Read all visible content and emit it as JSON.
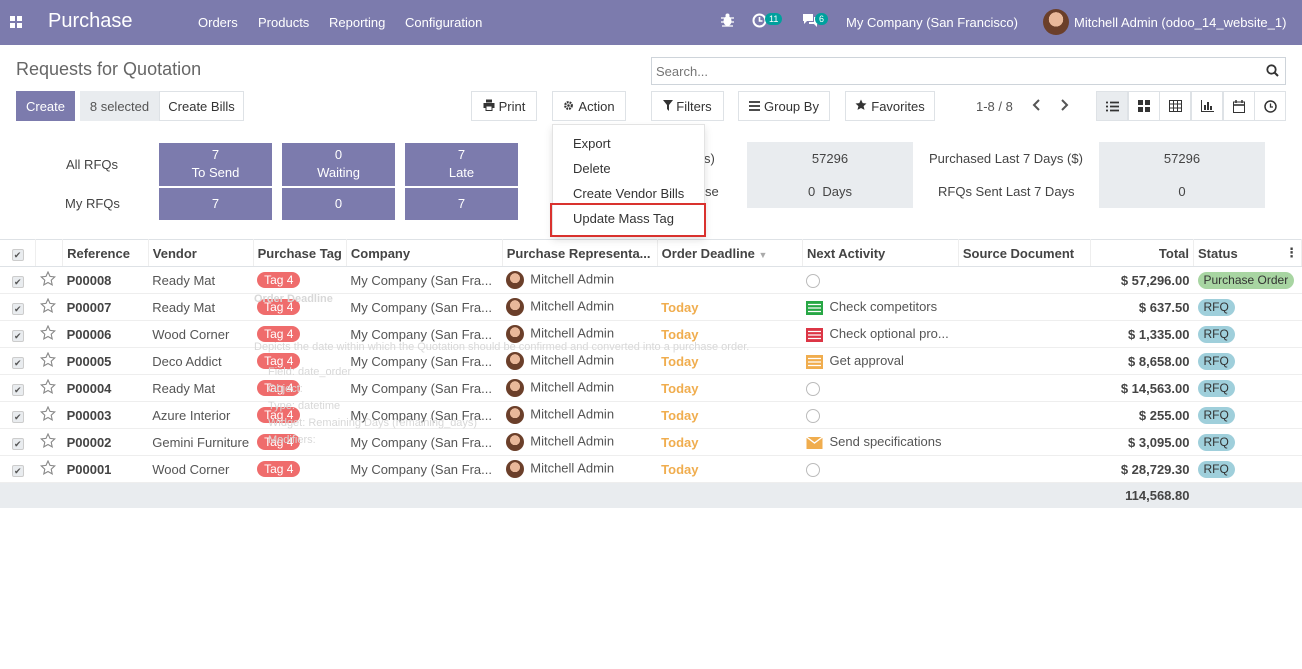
{
  "app": {
    "name": "Purchase"
  },
  "menu": [
    "Orders",
    "Products",
    "Reporting",
    "Configuration"
  ],
  "systray": {
    "activity_count": "11",
    "message_count": "6",
    "company": "My Company (San Francisco)",
    "user": "Mitchell Admin (odoo_14_website_1)"
  },
  "page": {
    "title": "Requests for Quotation"
  },
  "buttons": {
    "create": "Create",
    "selected": "8 selected",
    "create_bills": "Create Bills",
    "print": "Print",
    "action": "Action",
    "filters": "Filters",
    "group_by": "Group By",
    "favorites": "Favorites"
  },
  "search": {
    "placeholder": "Search..."
  },
  "pager": "1-8 / 8",
  "dashboard": {
    "all_rfqs": "All RFQs",
    "my_rfqs": "My RFQs",
    "tiles": [
      {
        "all": "7",
        "mine": "7",
        "label": "To Send"
      },
      {
        "all": "0",
        "mine": "0",
        "label": "Waiting"
      },
      {
        "all": "7",
        "mine": "7",
        "label": "Late"
      }
    ],
    "stats": [
      {
        "label_partial": "s)",
        "value": "57296"
      },
      {
        "label_partial": "se",
        "value": "0  Days"
      }
    ],
    "stats_right": [
      {
        "label": "Purchased Last 7 Days ($)",
        "value": "57296"
      },
      {
        "label": "RFQs Sent Last 7 Days",
        "value": "0"
      }
    ]
  },
  "action_menu": [
    "Export",
    "Delete",
    "Create Vendor Bills",
    "Update Mass Tag"
  ],
  "table": {
    "columns": [
      "Reference",
      "Vendor",
      "Purchase Tag",
      "Company",
      "Purchase Representa...",
      "Order Deadline",
      "Next Activity",
      "Source Document",
      "Total",
      "Status"
    ],
    "rows": [
      {
        "ref": "P00008",
        "vendor": "Ready Mat",
        "tag": "Tag 4",
        "company": "My Company (San Fra...",
        "rep": "Mitchell Admin",
        "deadline": "",
        "activity": "",
        "activity_icon": "clock-icon",
        "total": "$ 57,296.00",
        "status": "Purchase Order"
      },
      {
        "ref": "P00007",
        "vendor": "Ready Mat",
        "tag": "Tag 4",
        "company": "My Company (San Fra...",
        "rep": "Mitchell Admin",
        "deadline": "Today",
        "activity": "Check competitors",
        "activity_icon": "tasks-icon",
        "total": "$ 637.50",
        "status": "RFQ"
      },
      {
        "ref": "P00006",
        "vendor": "Wood Corner",
        "tag": "Tag 4",
        "company": "My Company (San Fra...",
        "rep": "Mitchell Admin",
        "deadline": "Today",
        "activity": "Check optional pro...",
        "activity_icon": "tasks-icon",
        "total": "$ 1,335.00",
        "status": "RFQ"
      },
      {
        "ref": "P00005",
        "vendor": "Deco Addict",
        "tag": "Tag 4",
        "company": "My Company (San Fra...",
        "rep": "Mitchell Admin",
        "deadline": "Today",
        "activity": "Get approval",
        "activity_icon": "tasks-icon",
        "total": "$ 8,658.00",
        "status": "RFQ"
      },
      {
        "ref": "P00004",
        "vendor": "Ready Mat",
        "tag": "Tag 4",
        "company": "My Company (San Fra...",
        "rep": "Mitchell Admin",
        "deadline": "Today",
        "activity": "",
        "activity_icon": "clock-icon",
        "total": "$ 14,563.00",
        "status": "RFQ"
      },
      {
        "ref": "P00003",
        "vendor": "Azure Interior",
        "tag": "Tag 4",
        "company": "My Company (San Fra...",
        "rep": "Mitchell Admin",
        "deadline": "Today",
        "activity": "",
        "activity_icon": "clock-icon",
        "total": "$ 255.00",
        "status": "RFQ"
      },
      {
        "ref": "P00002",
        "vendor": "Gemini Furniture",
        "tag": "Tag 4",
        "company": "My Company (San Fra...",
        "rep": "Mitchell Admin",
        "deadline": "Today",
        "activity": "Send specifications",
        "activity_icon": "envelope-icon",
        "total": "$ 3,095.00",
        "status": "RFQ"
      },
      {
        "ref": "P00001",
        "vendor": "Wood Corner",
        "tag": "Tag 4",
        "company": "My Company (San Fra...",
        "rep": "Mitchell Admin",
        "deadline": "Today",
        "activity": "",
        "activity_icon": "clock-icon",
        "total": "$ 28,729.30",
        "status": "RFQ"
      }
    ],
    "footer_total": "114,568.80"
  },
  "tooltip": {
    "title": "Order Deadline",
    "desc": "Depicts the date within which the Quotation should be confirmed and converted into a purchase order.",
    "field": "Field: date_order",
    "object": "Object:",
    "type": "Type: datetime",
    "widget": "Widget: Remaining Days (remaining_days)",
    "modifiers": "Modifiers:"
  },
  "colors": {
    "brand": "#7c7bad",
    "tag": "#ef6c6c",
    "today": "#f0ad4e",
    "po": "#a8d5a2",
    "rfq": "#9fcfdb",
    "highlight": "#d9322e"
  }
}
